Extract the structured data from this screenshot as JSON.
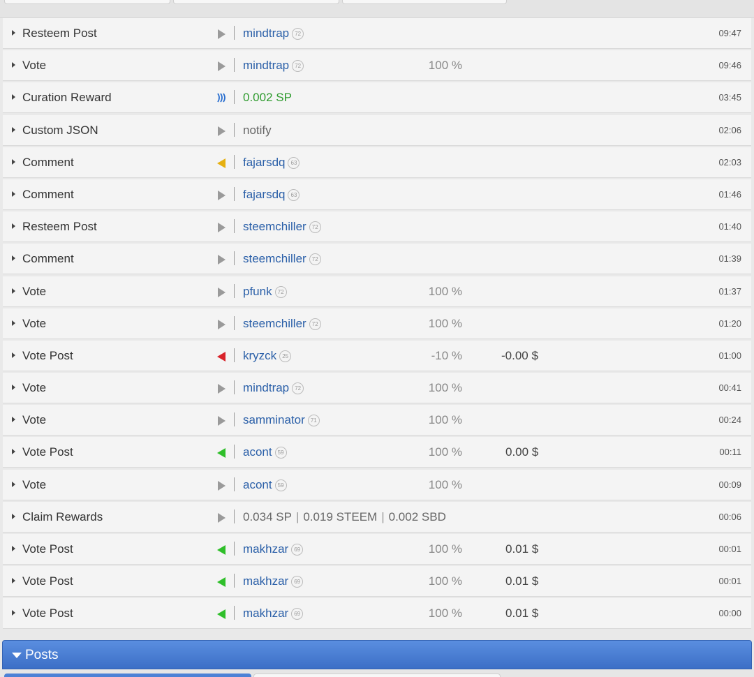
{
  "rows": [
    {
      "op": "Resteem Post",
      "dir": "right",
      "target": "mindtrap",
      "rep": "72",
      "pct": "",
      "val": "",
      "time": "09:47"
    },
    {
      "op": "Vote",
      "dir": "right",
      "target": "mindtrap",
      "rep": "72",
      "pct": "100 %",
      "val": "",
      "time": "09:46"
    },
    {
      "op": "Curation Reward",
      "dir": "steem",
      "amount": "0.002 SP",
      "time": "03:45"
    },
    {
      "op": "Custom JSON",
      "dir": "right",
      "plain": "notify",
      "time": "02:06"
    },
    {
      "op": "Comment",
      "dir": "left-yellow",
      "target": "fajarsdq",
      "rep": "63",
      "pct": "",
      "val": "",
      "time": "02:03"
    },
    {
      "op": "Comment",
      "dir": "right",
      "target": "fajarsdq",
      "rep": "63",
      "pct": "",
      "val": "",
      "time": "01:46"
    },
    {
      "op": "Resteem Post",
      "dir": "right",
      "target": "steemchiller",
      "rep": "72",
      "pct": "",
      "val": "",
      "time": "01:40"
    },
    {
      "op": "Comment",
      "dir": "right",
      "target": "steemchiller",
      "rep": "72",
      "pct": "",
      "val": "",
      "time": "01:39"
    },
    {
      "op": "Vote",
      "dir": "right",
      "target": "pfunk",
      "rep": "72",
      "pct": "100 %",
      "val": "",
      "time": "01:37"
    },
    {
      "op": "Vote",
      "dir": "right",
      "target": "steemchiller",
      "rep": "72",
      "pct": "100 %",
      "val": "",
      "time": "01:20"
    },
    {
      "op": "Vote Post",
      "dir": "left-red",
      "target": "kryzck",
      "rep": "25",
      "pct": "-10 %",
      "val": "-0.00 $",
      "time": "01:00"
    },
    {
      "op": "Vote",
      "dir": "right",
      "target": "mindtrap",
      "rep": "72",
      "pct": "100 %",
      "val": "",
      "time": "00:41"
    },
    {
      "op": "Vote",
      "dir": "right",
      "target": "samminator",
      "rep": "71",
      "pct": "100 %",
      "val": "",
      "time": "00:24"
    },
    {
      "op": "Vote Post",
      "dir": "left-green",
      "target": "acont",
      "rep": "59",
      "pct": "100 %",
      "val": "0.00 $",
      "time": "00:11"
    },
    {
      "op": "Vote",
      "dir": "right",
      "target": "acont",
      "rep": "59",
      "pct": "100 %",
      "val": "",
      "time": "00:09"
    },
    {
      "op": "Claim Rewards",
      "dir": "right",
      "claim": [
        "0.034 SP",
        "0.019 STEEM",
        "0.002 SBD"
      ],
      "time": "00:06"
    },
    {
      "op": "Vote Post",
      "dir": "left-green",
      "target": "makhzar",
      "rep": "69",
      "pct": "100 %",
      "val": "0.01 $",
      "time": "00:01"
    },
    {
      "op": "Vote Post",
      "dir": "left-green",
      "target": "makhzar",
      "rep": "69",
      "pct": "100 %",
      "val": "0.01 $",
      "time": "00:01"
    },
    {
      "op": "Vote Post",
      "dir": "left-green",
      "target": "makhzar",
      "rep": "69",
      "pct": "100 %",
      "val": "0.01 $",
      "time": "00:00"
    }
  ],
  "posts_section": {
    "label": "Posts"
  },
  "colors": {
    "link": "#2a5fa8",
    "reward": "#2d9a2d",
    "posts_bar": "#4a7fd4"
  }
}
